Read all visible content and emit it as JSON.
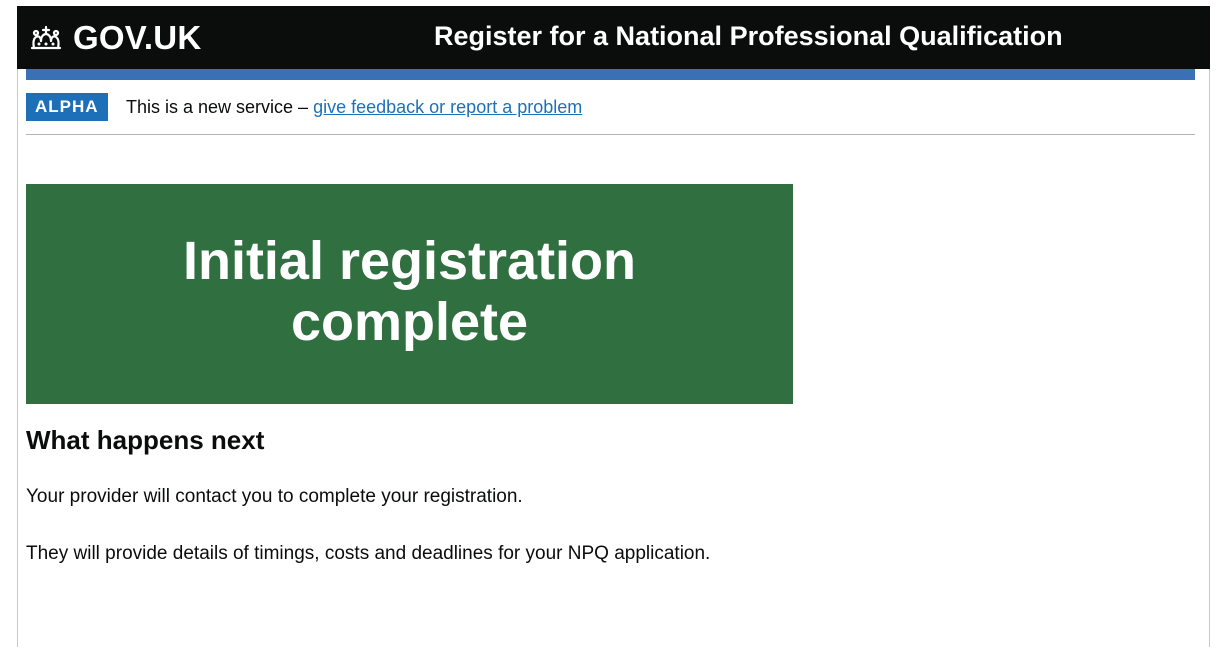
{
  "header": {
    "logo_text": "GOV.UK",
    "logo_icon": "crown-icon",
    "service_name": "Register for a National Professional Qualification"
  },
  "phase_banner": {
    "tag": "ALPHA",
    "text": "This is a new service –",
    "link": "give feedback or report a problem"
  },
  "confirmation_panel": {
    "title_line_1": "Initial registration",
    "title_line_2": "complete"
  },
  "main": {
    "heading": "What happens next",
    "paragraphs": [
      "Your provider will contact you to complete your registration.",
      "They will provide details of timings, costs and deadlines for your NPQ application."
    ]
  },
  "colors": {
    "header_background": "#0b0c0c",
    "blue_bar": "#3a70b5",
    "phase_tag": "#1d70b8",
    "confirmation_panel": "#307040",
    "link": "#1d70b8"
  }
}
